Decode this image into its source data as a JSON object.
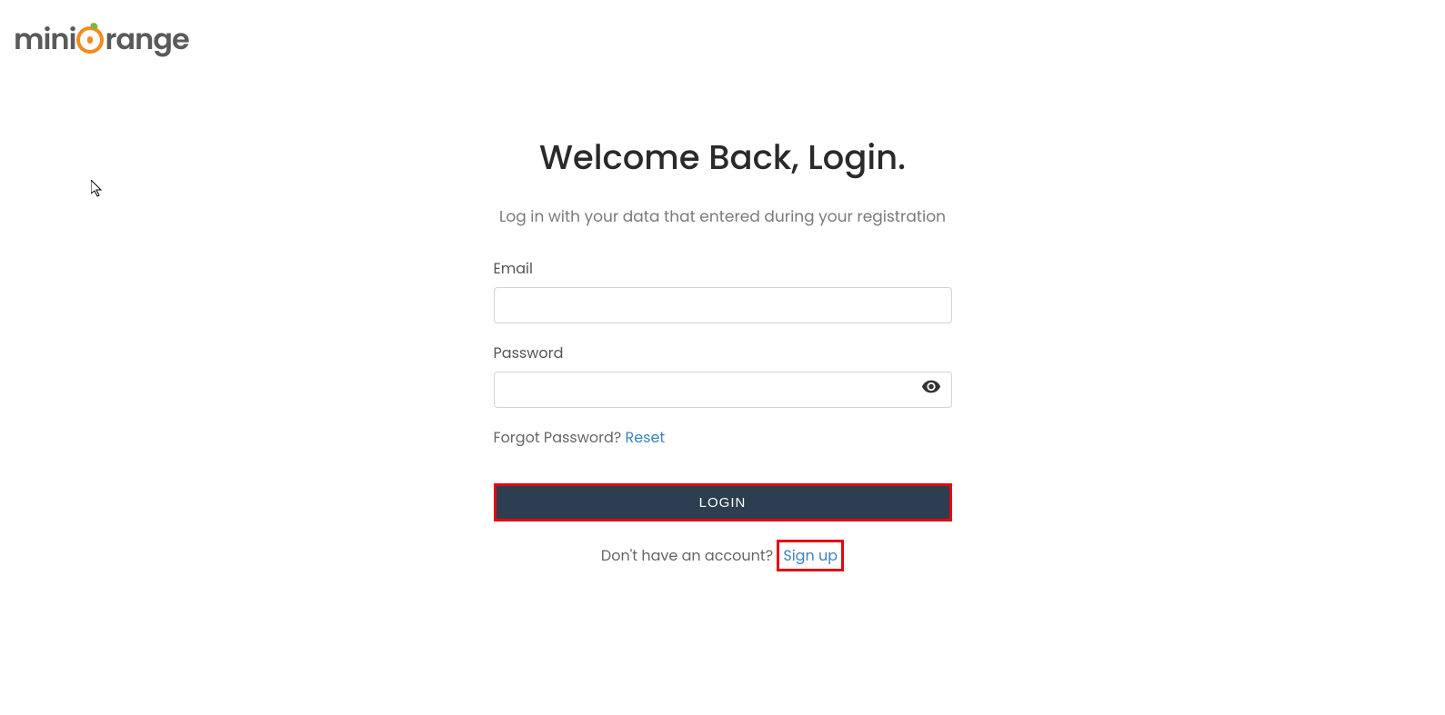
{
  "logo": {
    "text_mini": "mini",
    "text_range": "range"
  },
  "login": {
    "title": "Welcome Back, Login.",
    "subtitle": "Log in with your data that entered during your registration",
    "email_label": "Email",
    "password_label": "Password",
    "forgot_text": "Forgot Password? ",
    "reset_link": "Reset",
    "login_button": "LOGIN",
    "no_account_text": "Don't have an account? ",
    "signup_link": "Sign up"
  }
}
